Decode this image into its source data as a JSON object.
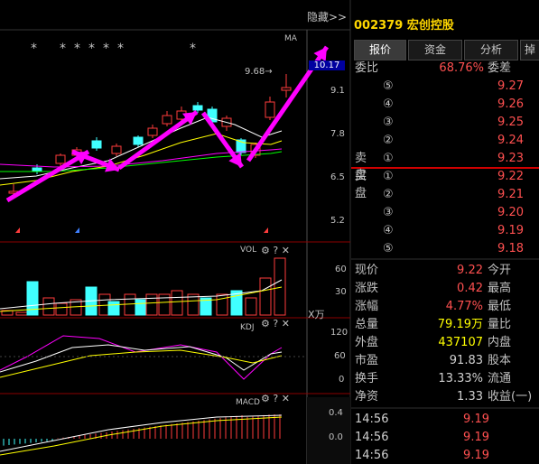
{
  "header": {
    "hide_label": "隐藏>>",
    "code": "002379",
    "name": "宏创控股"
  },
  "tabs": [
    {
      "label": "报价"
    },
    {
      "label": "资金"
    },
    {
      "label": "分析"
    },
    {
      "label": "掉"
    }
  ],
  "quote": {
    "weibi_label": "委比",
    "weibi_value": "68.76%",
    "weicha_label": "委差",
    "sell_label": "卖盘",
    "sell": [
      {
        "label": "⑤",
        "price": "9.27"
      },
      {
        "label": "④",
        "price": "9.26"
      },
      {
        "label": "③",
        "price": "9.25"
      },
      {
        "label": "②",
        "price": "9.24"
      },
      {
        "label": "①",
        "price": "9.23"
      }
    ],
    "buy_label": "买盘",
    "buy": [
      {
        "label": "①",
        "price": "9.22"
      },
      {
        "label": "②",
        "price": "9.21"
      },
      {
        "label": "③",
        "price": "9.20"
      },
      {
        "label": "④",
        "price": "9.19"
      },
      {
        "label": "⑤",
        "price": "9.18"
      }
    ],
    "stats": [
      {
        "l": "现价",
        "v": "9.22",
        "r": "今开"
      },
      {
        "l": "涨跌",
        "v": "0.42",
        "r": "最高"
      },
      {
        "l": "涨幅",
        "v": "4.77%",
        "r": "最低"
      },
      {
        "l": "总量",
        "v": "79.19万",
        "r": "量比"
      },
      {
        "l": "外盘",
        "v": "437107",
        "r": "内盘"
      },
      {
        "l": "市盈",
        "v": "91.83",
        "r": "股本"
      },
      {
        "l": "换手",
        "v": "13.33%",
        "r": "流通"
      },
      {
        "l": "净资",
        "v": "1.33",
        "r": "收益(一)"
      }
    ],
    "ticks": [
      {
        "time": "14:56",
        "price": "9.19"
      },
      {
        "time": "14:56",
        "price": "9.19"
      },
      {
        "time": "14:56",
        "price": "9.19"
      }
    ]
  },
  "price_chart": {
    "ma_label": "MA",
    "high_label": "9.68→",
    "current_price": "10.17",
    "y_ticks": [
      "9.1",
      "7.8",
      "6.5",
      "5.2"
    ],
    "stars": [
      "*",
      "*",
      "*",
      "*",
      "*",
      "*",
      "*"
    ]
  },
  "vol_panel": {
    "title": "VOL",
    "y_ticks": [
      "60",
      "30"
    ],
    "unit": "X万"
  },
  "kdj_panel": {
    "title": "KDJ",
    "y_ticks": [
      "120",
      "60",
      "0"
    ]
  },
  "macd_panel": {
    "title": "MACD",
    "y_ticks": [
      "0.4",
      "0.0"
    ]
  },
  "colors": {
    "up": "#ff3c3c",
    "down": "#40ffff",
    "price": "#ff5050",
    "code": "#ffd700",
    "arrow": "#ff00ff"
  }
}
